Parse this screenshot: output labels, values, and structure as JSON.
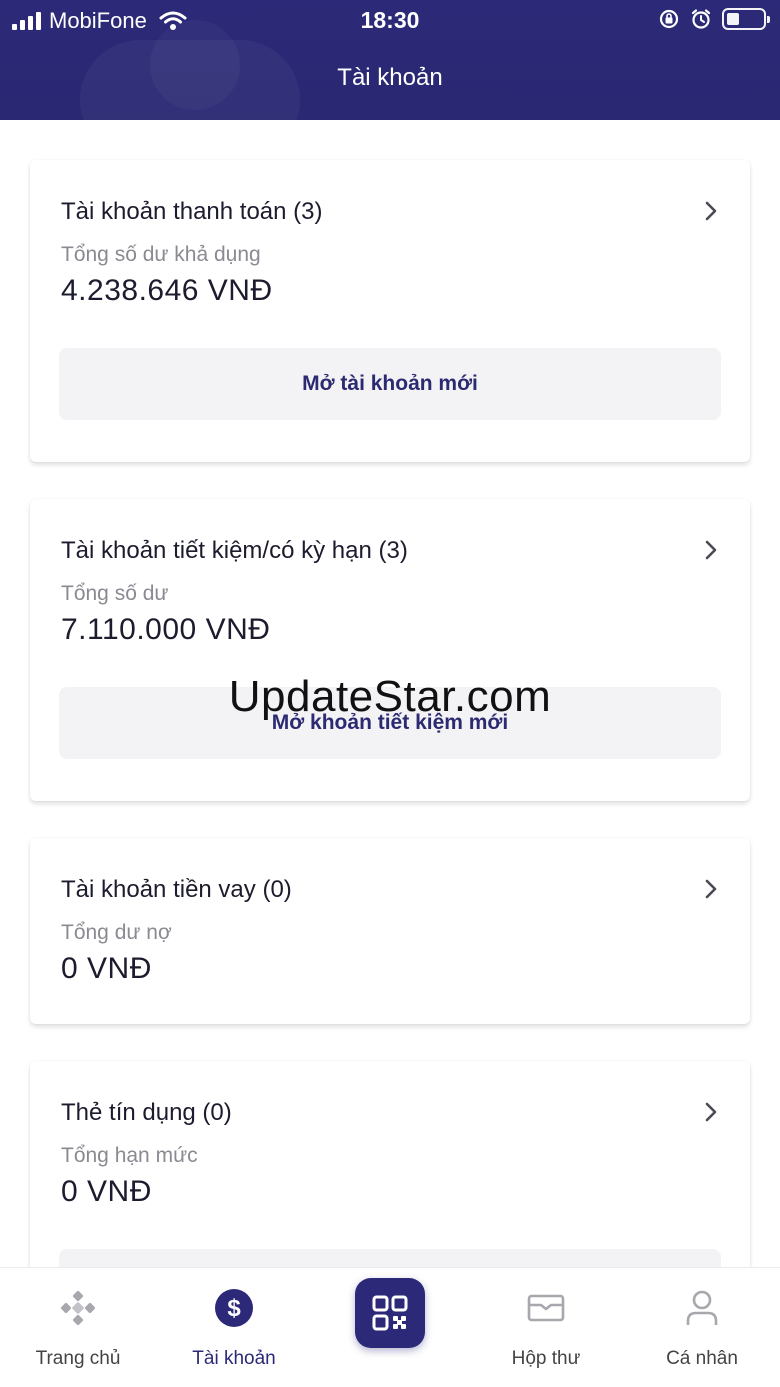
{
  "status_bar": {
    "carrier": "MobiFone",
    "time": "18:30"
  },
  "header": {
    "title": "Tài khoản"
  },
  "cards": [
    {
      "title": "Tài khoản thanh toán (3)",
      "subtitle": "Tổng số dư khả dụng",
      "amount": "4.238.646 VNĐ",
      "button_label": "Mở tài khoản mới"
    },
    {
      "title": "Tài khoản tiết kiệm/có kỳ hạn (3)",
      "subtitle": "Tổng số dư",
      "amount": "7.110.000 VNĐ",
      "button_label": "Mở khoản tiết kiệm mới"
    },
    {
      "title": "Tài khoản tiền vay (0)",
      "subtitle": "Tổng dư nợ",
      "amount": "0 VNĐ"
    },
    {
      "title": "Thẻ tín dụng (0)",
      "subtitle": "Tổng hạn mức",
      "amount": "0 VNĐ"
    }
  ],
  "watermark": "UpdateStar.com",
  "bottom_nav": {
    "items": [
      {
        "label": "Trang chủ",
        "icon": "home-diamond-icon"
      },
      {
        "label": "Tài khoản",
        "icon": "dollar-circle-icon",
        "active": true
      },
      {
        "label": "",
        "icon": "qr-code-icon"
      },
      {
        "label": "Hộp thư",
        "icon": "mail-icon"
      },
      {
        "label": "Cá nhân",
        "icon": "person-icon"
      }
    ]
  },
  "colors": {
    "brand": "#2c2a78",
    "button_bg": "#f3f3f6",
    "muted_text": "#8a8a92"
  }
}
